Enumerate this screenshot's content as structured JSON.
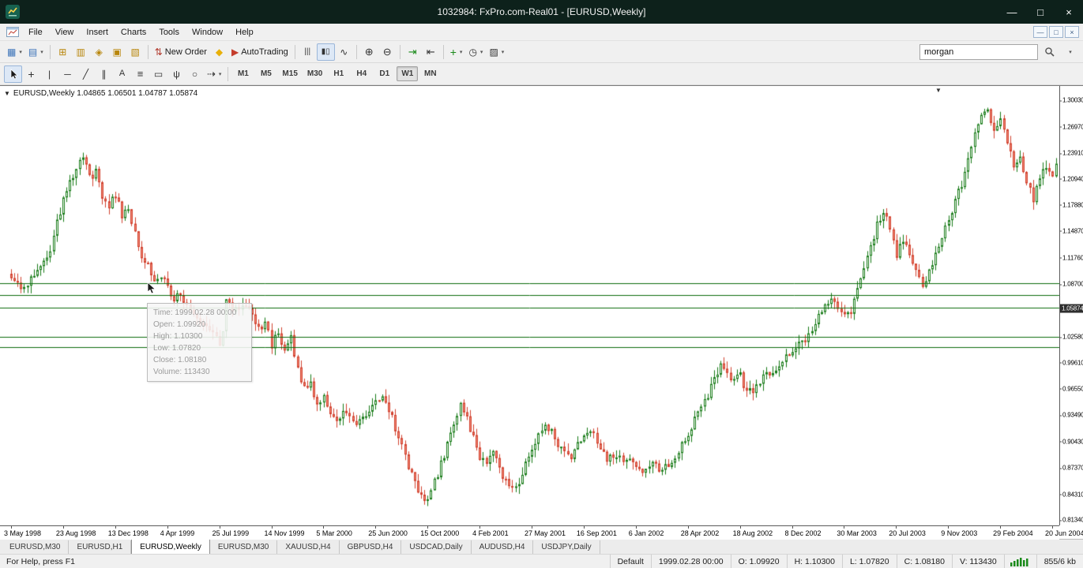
{
  "window": {
    "title": "1032984: FxPro.com-Real01 - [EURUSD,Weekly]",
    "controls": {
      "minimize": "—",
      "maximize": "□",
      "close": "×"
    },
    "mdi": {
      "minimize": "—",
      "restore": "□",
      "close": "×"
    }
  },
  "menu": {
    "items": [
      "File",
      "View",
      "Insert",
      "Charts",
      "Tools",
      "Window",
      "Help"
    ]
  },
  "toolbar_main": {
    "groups": [
      {
        "buttons": [
          {
            "name": "new-chart-button",
            "glyph": "▦",
            "color": "#3a72b8",
            "dropdown": true
          },
          {
            "name": "profiles-button",
            "glyph": "▤",
            "color": "#3a72b8",
            "dropdown": true
          }
        ]
      },
      {
        "buttons": [
          {
            "name": "market-watch-button",
            "glyph": "⊞",
            "color": "#b8860b"
          },
          {
            "name": "data-window-button",
            "glyph": "▥",
            "color": "#b8860b"
          },
          {
            "name": "navigator-button",
            "glyph": "◈",
            "color": "#b8860b"
          },
          {
            "name": "terminal-button",
            "glyph": "▣",
            "color": "#b8860b"
          },
          {
            "name": "strategy-tester-button",
            "glyph": "▧",
            "color": "#b8860b"
          }
        ]
      },
      {
        "buttons": [
          {
            "name": "new-order-button",
            "glyph": "⇅",
            "color": "#b23b2e",
            "label": "New Order"
          },
          {
            "name": "metaeditor-button",
            "glyph": "◆",
            "color": "#e8b00a"
          },
          {
            "name": "autotrading-button",
            "glyph": "▶",
            "color": "#c43c2c",
            "label": "AutoTrading"
          }
        ]
      },
      {
        "buttons": [
          {
            "name": "bar-chart-mode-button",
            "glyph": "|||",
            "size": 10
          },
          {
            "name": "candlestick-mode-button",
            "glyph": "▮▯",
            "size": 10,
            "pressed": true
          },
          {
            "name": "line-chart-mode-button",
            "glyph": "∿",
            "size": 12
          }
        ]
      },
      {
        "buttons": [
          {
            "name": "zoom-in-button",
            "glyph": "⊕",
            "size": 13
          },
          {
            "name": "zoom-out-button",
            "glyph": "⊖",
            "size": 13
          }
        ]
      },
      {
        "buttons": [
          {
            "name": "auto-scroll-button",
            "glyph": "⇥",
            "size": 13,
            "color": "#1a8a1a"
          },
          {
            "name": "chart-shift-button",
            "glyph": "⇤",
            "size": 13
          }
        ]
      },
      {
        "buttons": [
          {
            "name": "indicators-button",
            "glyph": "+",
            "color": "#1a8a1a",
            "size": 14,
            "dropdown": true
          },
          {
            "name": "periods-button",
            "glyph": "◷",
            "size": 12,
            "dropdown": true
          },
          {
            "name": "templates-button",
            "glyph": "▨",
            "size": 12,
            "dropdown": true
          }
        ]
      }
    ],
    "search": {
      "value": "morgan"
    }
  },
  "toolbar_tools": {
    "tools": [
      {
        "name": "cursor-tool",
        "svg": "cursor",
        "pressed": true
      },
      {
        "name": "crosshair-tool",
        "glyph": "+",
        "size": 14
      },
      {
        "name": "vertical-line-tool",
        "glyph": "|",
        "size": 12
      },
      {
        "name": "horizontal-line-tool",
        "glyph": "─",
        "size": 12
      },
      {
        "name": "trendline-tool",
        "glyph": "╱",
        "size": 12
      },
      {
        "name": "equidistant-channel-tool",
        "glyph": "∥",
        "size": 12
      },
      {
        "name": "text-tool",
        "glyph": "A",
        "size": 11
      },
      {
        "name": "fibonacci-tool",
        "glyph": "≡",
        "size": 13
      },
      {
        "name": "rectangle-tool",
        "glyph": "▭",
        "size": 12
      },
      {
        "name": "pitchfork-tool",
        "glyph": "ψ",
        "size": 12
      },
      {
        "name": "ellipse-tool",
        "glyph": "○",
        "size": 12
      },
      {
        "name": "arrows-tool",
        "glyph": "⇢",
        "size": 13,
        "dropdown": true
      }
    ],
    "timeframes": {
      "items": [
        "M1",
        "M5",
        "M15",
        "M30",
        "H1",
        "H4",
        "D1",
        "W1",
        "MN"
      ],
      "active": "W1"
    }
  },
  "chart": {
    "collapse_arrow": "▼",
    "symbol_line": "EURUSD,Weekly 1.04865 1.06501 1.04787 1.05874",
    "tooltip": {
      "time": "Time: 1999.02.28 00:00",
      "open": "Open: 1.09920",
      "high": "High: 1.10300",
      "low": "Low: 1.07820",
      "close": "Close: 1.08180",
      "volume": "Volume: 113430"
    },
    "price_badge": "1.05874",
    "price_ticks": [
      "1.30030",
      "1.26970",
      "1.23910",
      "1.20940",
      "1.17880",
      "1.14870",
      "1.11760",
      "1.08700",
      "1.02580",
      "0.99610",
      "0.96550",
      "0.93490",
      "0.90430",
      "0.87370",
      "0.84310",
      "0.81340"
    ],
    "date_ticks": [
      "3 May 1998",
      "23 Aug 1998",
      "13 Dec 1998",
      "4 Apr 1999",
      "25 Jul 1999",
      "14 Nov 1999",
      "5 Mar 2000",
      "25 Jun 2000",
      "15 Oct 2000",
      "4 Feb 2001",
      "27 May 2001",
      "16 Sep 2001",
      "6 Jan 2002",
      "28 Apr 2002",
      "18 Aug 2002",
      "8 Dec 2002",
      "30 Mar 2003",
      "20 Jul 2003",
      "9 Nov 2003",
      "29 Feb 2004",
      "20 Jun 2004"
    ]
  },
  "chart_data": {
    "type": "candlestick",
    "symbol": "EURUSD",
    "timeframe": "Weekly",
    "visible_price_range": [
      0.807,
      1.317
    ],
    "weeks_visible": 322,
    "marker_week": 285,
    "hlines": [
      1.0885,
      1.0742,
      1.0598,
      1.0262,
      1.0137
    ],
    "colors": {
      "bull": "#157a15",
      "bear": "#d0402e",
      "bear_fill": "#f28a76",
      "hline": "#0b6b0b"
    },
    "price_path_anchors": [
      [
        0,
        1.095
      ],
      [
        3,
        1.078
      ],
      [
        5,
        1.09
      ],
      [
        8,
        1.101
      ],
      [
        11,
        1.115
      ],
      [
        14,
        1.16
      ],
      [
        17,
        1.196
      ],
      [
        20,
        1.222
      ],
      [
        22,
        1.232
      ],
      [
        24,
        1.209
      ],
      [
        26,
        1.218
      ],
      [
        28,
        1.186
      ],
      [
        30,
        1.178
      ],
      [
        32,
        1.19
      ],
      [
        34,
        1.168
      ],
      [
        36,
        1.173
      ],
      [
        38,
        1.146
      ],
      [
        40,
        1.122
      ],
      [
        42,
        1.108
      ],
      [
        44,
        1.088
      ],
      [
        46,
        1.096
      ],
      [
        48,
        1.082
      ],
      [
        50,
        1.072
      ],
      [
        52,
        1.078
      ],
      [
        54,
        1.062
      ],
      [
        56,
        1.048
      ],
      [
        58,
        1.042
      ],
      [
        60,
        1.034
      ],
      [
        62,
        1.027
      ],
      [
        64,
        1.019
      ],
      [
        65,
        1.036
      ],
      [
        66,
        1.072
      ],
      [
        68,
        1.058
      ],
      [
        70,
        1.053
      ],
      [
        72,
        1.061
      ],
      [
        74,
        1.049
      ],
      [
        76,
        1.036
      ],
      [
        78,
        1.043
      ],
      [
        80,
        1.017
      ],
      [
        82,
        1.029
      ],
      [
        84,
        1.012
      ],
      [
        86,
        1.027
      ],
      [
        88,
        0.988
      ],
      [
        90,
        0.968
      ],
      [
        92,
        0.972
      ],
      [
        94,
        0.948
      ],
      [
        96,
        0.953
      ],
      [
        98,
        0.936
      ],
      [
        100,
        0.93
      ],
      [
        102,
        0.943
      ],
      [
        104,
        0.936
      ],
      [
        106,
        0.922
      ],
      [
        108,
        0.93
      ],
      [
        110,
        0.939
      ],
      [
        112,
        0.949
      ],
      [
        114,
        0.953
      ],
      [
        116,
        0.942
      ],
      [
        118,
        0.92
      ],
      [
        120,
        0.898
      ],
      [
        122,
        0.874
      ],
      [
        124,
        0.858
      ],
      [
        126,
        0.843
      ],
      [
        128,
        0.838
      ],
      [
        130,
        0.856
      ],
      [
        132,
        0.877
      ],
      [
        134,
        0.899
      ],
      [
        136,
        0.925
      ],
      [
        138,
        0.945
      ],
      [
        140,
        0.93
      ],
      [
        142,
        0.908
      ],
      [
        144,
        0.888
      ],
      [
        146,
        0.879
      ],
      [
        148,
        0.89
      ],
      [
        150,
        0.874
      ],
      [
        152,
        0.859
      ],
      [
        154,
        0.848
      ],
      [
        156,
        0.857
      ],
      [
        158,
        0.877
      ],
      [
        160,
        0.893
      ],
      [
        162,
        0.913
      ],
      [
        164,
        0.925
      ],
      [
        166,
        0.914
      ],
      [
        168,
        0.899
      ],
      [
        170,
        0.889
      ],
      [
        172,
        0.885
      ],
      [
        174,
        0.9
      ],
      [
        176,
        0.91
      ],
      [
        178,
        0.92
      ],
      [
        180,
        0.904
      ],
      [
        182,
        0.889
      ],
      [
        184,
        0.884
      ],
      [
        186,
        0.89
      ],
      [
        188,
        0.879
      ],
      [
        190,
        0.885
      ],
      [
        192,
        0.874
      ],
      [
        194,
        0.869
      ],
      [
        196,
        0.88
      ],
      [
        198,
        0.874
      ],
      [
        200,
        0.869
      ],
      [
        202,
        0.88
      ],
      [
        204,
        0.89
      ],
      [
        206,
        0.9
      ],
      [
        208,
        0.915
      ],
      [
        210,
        0.93
      ],
      [
        212,
        0.945
      ],
      [
        214,
        0.96
      ],
      [
        216,
        0.975
      ],
      [
        218,
        0.99
      ],
      [
        220,
        0.985
      ],
      [
        222,
        0.975
      ],
      [
        224,
        0.98
      ],
      [
        226,
        0.96
      ],
      [
        228,
        0.965
      ],
      [
        230,
        0.975
      ],
      [
        232,
        0.985
      ],
      [
        234,
        0.98
      ],
      [
        236,
        0.99
      ],
      [
        238,
        1.0
      ],
      [
        240,
        1.01
      ],
      [
        242,
        1.025
      ],
      [
        244,
        1.02
      ],
      [
        246,
        1.035
      ],
      [
        248,
        1.05
      ],
      [
        250,
        1.06
      ],
      [
        252,
        1.075
      ],
      [
        254,
        1.06
      ],
      [
        256,
        1.047
      ],
      [
        258,
        1.058
      ],
      [
        260,
        1.08
      ],
      [
        262,
        1.1
      ],
      [
        264,
        1.13
      ],
      [
        266,
        1.155
      ],
      [
        268,
        1.175
      ],
      [
        270,
        1.15
      ],
      [
        272,
        1.122
      ],
      [
        274,
        1.137
      ],
      [
        276,
        1.122
      ],
      [
        278,
        1.102
      ],
      [
        280,
        1.087
      ],
      [
        282,
        1.102
      ],
      [
        284,
        1.12
      ],
      [
        286,
        1.145
      ],
      [
        288,
        1.165
      ],
      [
        290,
        1.185
      ],
      [
        292,
        1.205
      ],
      [
        294,
        1.235
      ],
      [
        296,
        1.26
      ],
      [
        298,
        1.28
      ],
      [
        300,
        1.289
      ],
      [
        302,
        1.267
      ],
      [
        304,
        1.282
      ],
      [
        306,
        1.252
      ],
      [
        308,
        1.222
      ],
      [
        310,
        1.237
      ],
      [
        312,
        1.202
      ],
      [
        314,
        1.187
      ],
      [
        316,
        1.212
      ],
      [
        318,
        1.227
      ],
      [
        320,
        1.212
      ],
      [
        321,
        1.23
      ]
    ]
  },
  "tabs": {
    "items": [
      "EURUSD,M30",
      "EURUSD,H1",
      "EURUSD,Weekly",
      "EURUSD,M30",
      "XAUUSD,H4",
      "GBPUSD,H4",
      "USDCAD,Daily",
      "AUDUSD,H4",
      "USDJPY,Daily"
    ],
    "active_index": 2
  },
  "statusbar": {
    "help": "For Help, press F1",
    "profile": "Default",
    "time": "1999.02.28 00:00",
    "open": "O: 1.09920",
    "high": "H: 1.10300",
    "low": "L: 1.07820",
    "close": "C: 1.08180",
    "volume": "V: 113430",
    "traffic": "855/6 kb"
  }
}
